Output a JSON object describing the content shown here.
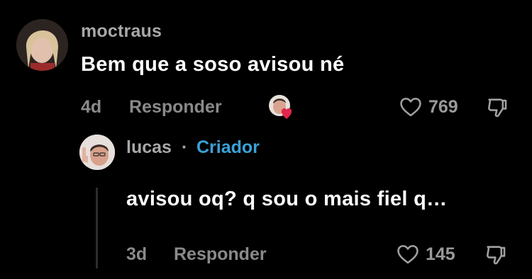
{
  "comment": {
    "username": "moctraus",
    "text": "Bem que a soso avisou né",
    "time": "4d",
    "reply_label": "Responder",
    "likes": "769"
  },
  "reply": {
    "username": "lucas",
    "separator": "·",
    "badge": "Criador",
    "text": "avisou oq? q sou o mais fiel q…",
    "time": "3d",
    "reply_label": "Responder",
    "likes": "145"
  },
  "colors": {
    "background": "#000000",
    "muted_text": "#8a8a8a",
    "creator_badge": "#3ba1d6",
    "creator_heart": "#e0254b"
  },
  "icons": {
    "like": "heart-outline-icon",
    "dislike": "thumbs-down-icon",
    "creator_like": "creator-liked-icon"
  }
}
